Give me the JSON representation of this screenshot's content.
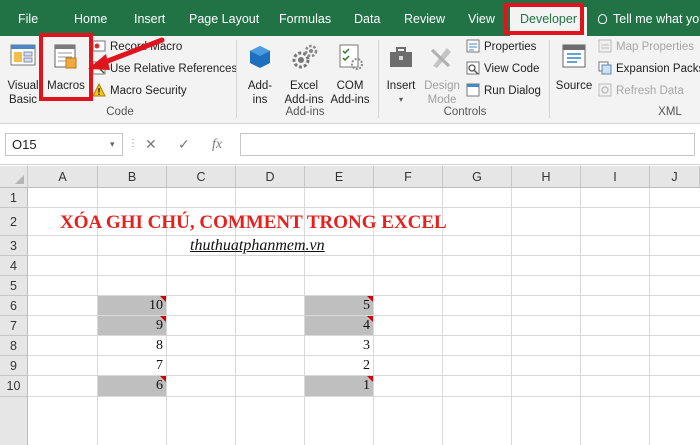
{
  "ribbon_tabs": {
    "file": "File",
    "home": "Home",
    "insert": "Insert",
    "page_layout": "Page Layout",
    "formulas": "Formulas",
    "data": "Data",
    "review": "Review",
    "view": "View",
    "developer": "Developer",
    "tell_me": "Tell me what you"
  },
  "code_group": {
    "label": "Code",
    "visual_basic": [
      "Visual",
      "Basic"
    ],
    "macros": "Macros",
    "record_macro": "Record Macro",
    "relative_refs": "Use Relative References",
    "macro_security": "Macro Security"
  },
  "addins_group": {
    "label": "Add-ins",
    "addins": [
      "Add-",
      "ins"
    ],
    "excel_addins": [
      "Excel",
      "Add-ins"
    ],
    "com_addins": [
      "COM",
      "Add-ins"
    ]
  },
  "controls_group": {
    "label": "Controls",
    "insert": "Insert",
    "design_mode": [
      "Design",
      "Mode"
    ],
    "properties": "Properties",
    "view_code": "View Code",
    "run_dialog": "Run Dialog"
  },
  "xml_group": {
    "label": "XML",
    "source": "Source",
    "map_properties": "Map Properties",
    "expansion_packs": "Expansion Packs",
    "refresh_data": "Refresh Data"
  },
  "formula_bar": {
    "name_box": "O15",
    "cancel_symbol": "✕",
    "enter_symbol": "✓",
    "fx_symbol": "fx",
    "formula": ""
  },
  "sheet": {
    "columns": [
      "A",
      "B",
      "C",
      "D",
      "E",
      "F",
      "G",
      "H",
      "I",
      "J"
    ],
    "rows": [
      "1",
      "2",
      "3",
      "4",
      "5",
      "6",
      "7",
      "8",
      "9",
      "10"
    ],
    "title": "XÓA GHI CHÚ, COMMENT TRONG EXCEL",
    "subtitle": "thuthuatphanmem.vn",
    "col_b_values": [
      "10",
      "9",
      "8",
      "7",
      "6"
    ],
    "col_e_values": [
      "5",
      "4",
      "3",
      "2",
      "1"
    ]
  },
  "colors": {
    "ribbon_green": "#217346",
    "title_red": "#e6201c",
    "highlight_red": "#e0141c",
    "comment_cell_gray": "#bfbfbf",
    "comment_marker": "#d40000"
  }
}
